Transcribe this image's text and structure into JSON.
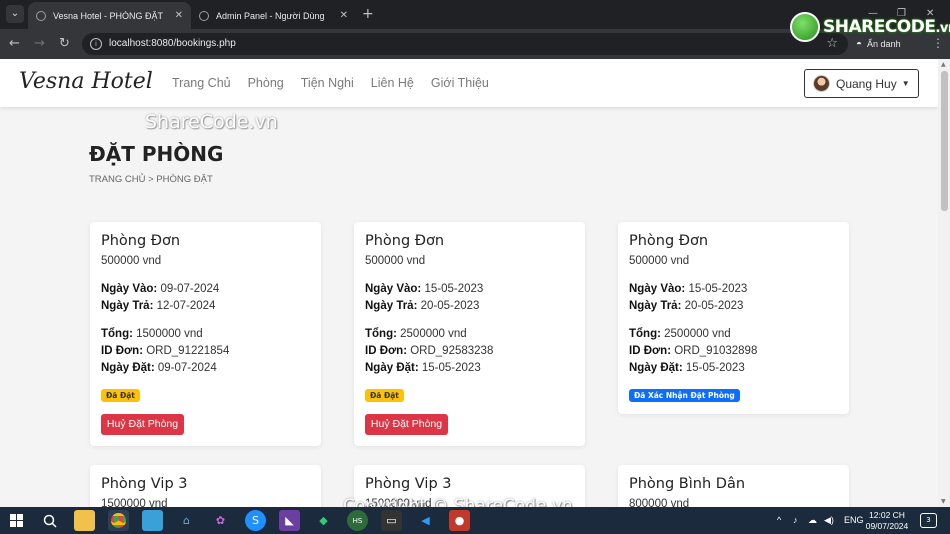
{
  "browser": {
    "tabs": [
      {
        "title": "Vesna Hotel - PHÒNG ĐẶT",
        "active": true
      },
      {
        "title": "Admin Panel - Người Dùng",
        "active": false
      }
    ],
    "url": "localhost:8080/bookings.php",
    "incognito_label": "Ẩn danh",
    "icons": [
      "back-arrow-icon",
      "forward-arrow-icon",
      "reload-icon",
      "star-icon",
      "incognito-icon",
      "kebab-menu-icon"
    ]
  },
  "watermark": {
    "logo_main": "SHARECODE",
    "logo_suffix": ".vn",
    "top_text": "ShareCode.vn",
    "bottom_text": "Copyright © ShareCode.vn"
  },
  "site": {
    "brand": "Vesna Hotel",
    "nav": [
      "Trang Chủ",
      "Phòng",
      "Tiện Nghi",
      "Liên Hệ",
      "Giới Thiệu"
    ],
    "user_name": "Quang Huy"
  },
  "page": {
    "title": "ĐẶT PHÒNG",
    "breadcrumb": "TRANG CHỦ > PHÒNG ĐẶT"
  },
  "labels": {
    "check_in": "Ngày Vào:",
    "check_out": "Ngày Trả:",
    "total": "Tổng:",
    "order_id": "ID Đơn:",
    "booked_date": "Ngày Đặt:",
    "cancel": "Huỷ Đặt Phòng"
  },
  "bookings": [
    {
      "room": "Phòng Đơn",
      "price": "500000 vnd",
      "check_in": "09-07-2024",
      "check_out": "12-07-2024",
      "total": "1500000 vnd",
      "order_id": "ORD_91221854",
      "booked_date": "09-07-2024",
      "status": "Đã Đặt",
      "status_color": "#ffc107",
      "cancelable": true
    },
    {
      "room": "Phòng Đơn",
      "price": "500000 vnd",
      "check_in": "15-05-2023",
      "check_out": "20-05-2023",
      "total": "2500000 vnd",
      "order_id": "ORD_92583238",
      "booked_date": "15-05-2023",
      "status": "Đã Đặt",
      "status_color": "#ffc107",
      "cancelable": true
    },
    {
      "room": "Phòng Đơn",
      "price": "500000 vnd",
      "check_in": "15-05-2023",
      "check_out": "20-05-2023",
      "total": "2500000 vnd",
      "order_id": "ORD_91032898",
      "booked_date": "15-05-2023",
      "status": "Đã Xác Nhận Đặt Phòng",
      "status_color": "#0d6efd",
      "cancelable": false
    },
    {
      "room": "Phòng Vip 3",
      "price": "1500000 vnd"
    },
    {
      "room": "Phòng Vip 3",
      "price": "1500000 vnd"
    },
    {
      "room": "Phòng Bình Dân",
      "price": "800000 vnd"
    }
  ],
  "taskbar": {
    "apps": [
      "windows-start-icon",
      "search-icon",
      "file-explorer-icon",
      "chrome-icon",
      "photos-icon",
      "network-icon",
      "app-icon",
      "skype-icon",
      "visual-studio-icon",
      "shield-app-icon",
      "hs-app-icon",
      "terminal-icon",
      "vscode-icon",
      "recorder-icon"
    ],
    "language": "ENG",
    "time": "12:02 CH",
    "date": "09/07/2024",
    "notifications": "3"
  }
}
